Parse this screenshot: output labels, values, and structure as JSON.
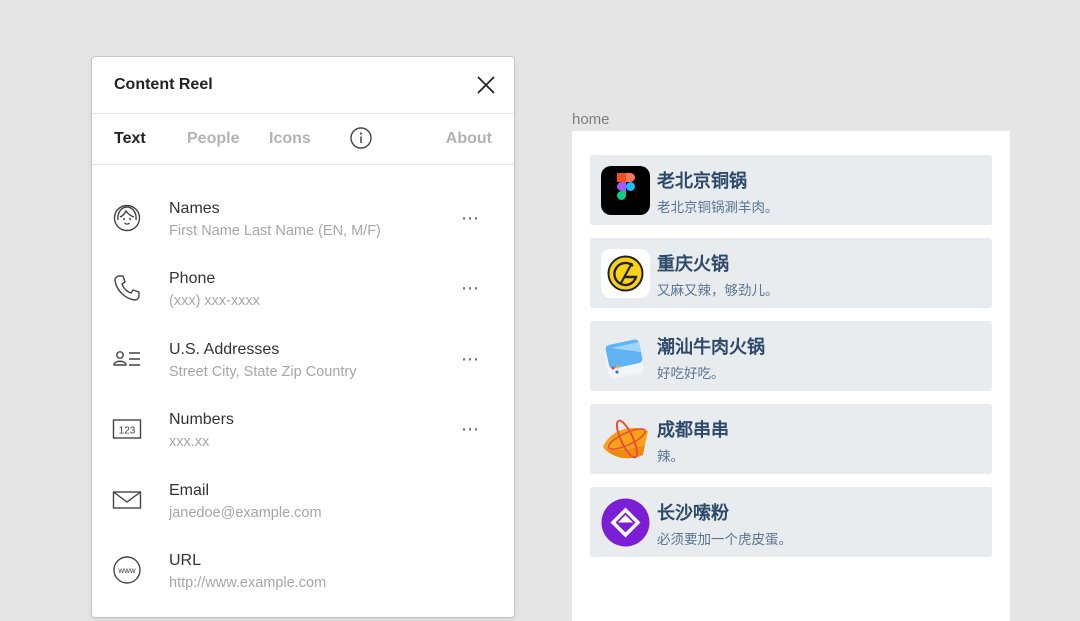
{
  "panel": {
    "title": "Content Reel",
    "tabs": [
      {
        "label": "Text",
        "active": true
      },
      {
        "label": "People",
        "active": false
      },
      {
        "label": "Icons",
        "active": false
      },
      {
        "label": "About",
        "active": false
      }
    ],
    "items": [
      {
        "name": "Names",
        "sub": "First Name Last Name (EN, M/F)",
        "icon": "person-face-icon",
        "more": "⋯"
      },
      {
        "name": "Phone",
        "sub": "(xxx) xxx-xxxx",
        "icon": "phone-icon",
        "more": "⋯"
      },
      {
        "name": "U.S. Addresses",
        "sub": "Street City, State Zip Country",
        "icon": "address-card-icon",
        "more": "⋯"
      },
      {
        "name": "Numbers",
        "sub": "xxx.xx",
        "icon": "numbers-icon",
        "icon_text": "123",
        "more": "⋯"
      },
      {
        "name": "Email",
        "sub": "janedoe@example.com",
        "icon": "envelope-icon"
      },
      {
        "name": "URL",
        "sub": "http://www.example.com",
        "icon": "globe-icon",
        "icon_text": "www"
      }
    ]
  },
  "frame": {
    "label": "home",
    "cards": [
      {
        "title": "老北京铜锅",
        "sub": "老北京铜锅涮羊肉。",
        "icon": "figma-logo-icon"
      },
      {
        "title": "重庆火锅",
        "sub": "又麻又辣，够劲儿。",
        "icon": "yellow-circle-logo-icon"
      },
      {
        "title": "潮汕牛肉火锅",
        "sub": "好吃好吃。",
        "icon": "blue-window-app-icon"
      },
      {
        "title": "成都串串",
        "sub": "辣。",
        "icon": "orange-atom-app-icon"
      },
      {
        "title": "长沙嗦粉",
        "sub": "必须要加一个虎皮蛋。",
        "icon": "purple-diamond-app-icon"
      }
    ]
  },
  "colors": {
    "background": "#e5e5e5",
    "card_bg": "#e9ecef",
    "card_title": "#2d4a6a",
    "card_sub": "#5a7590"
  }
}
